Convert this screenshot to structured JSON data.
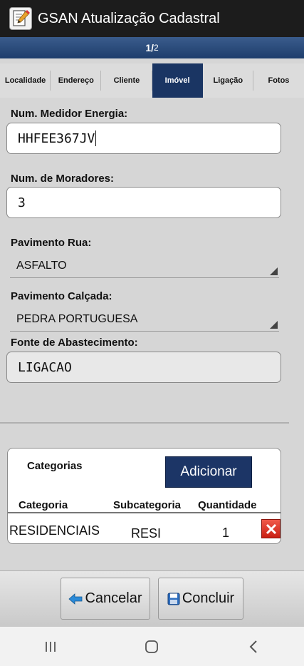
{
  "app": {
    "title": "GSAN Atualização Cadastral",
    "icon": "edit-icon"
  },
  "pager": {
    "current": "1",
    "separator": "/",
    "total": "2"
  },
  "tabs": [
    {
      "label": "Localidade"
    },
    {
      "label": "Endereço"
    },
    {
      "label": "Cliente"
    },
    {
      "label": "Imóvel",
      "active": true
    },
    {
      "label": "Ligação"
    },
    {
      "label": "Fotos"
    }
  ],
  "form": {
    "medidor": {
      "label": "Num. Medidor Energia:",
      "value": "HHFEE367JV"
    },
    "moradores": {
      "label": "Num. de Moradores:",
      "value": "3"
    },
    "pavimento_rua": {
      "label": "Pavimento Rua:",
      "value": "ASFALTO"
    },
    "pavimento_calcada": {
      "label": "Pavimento Calçada:",
      "value": "PEDRA PORTUGUESA"
    },
    "fonte": {
      "label": "Fonte de Abastecimento:",
      "value": "LIGACAO"
    }
  },
  "categorias": {
    "title": "Categorias",
    "add_label": "Adicionar",
    "headers": {
      "categoria": "Categoria",
      "subcategoria": "Subcategoria",
      "quantidade": "Quantidade"
    },
    "rows": [
      {
        "categoria": "RESIDENCIAIS",
        "subcategoria": "RESI",
        "quantidade": "1"
      }
    ]
  },
  "footer": {
    "cancel_label": "Cancelar",
    "confirm_label": "Concluir"
  },
  "colors": {
    "accent": "#1a3563",
    "delete": "#d9281a"
  }
}
